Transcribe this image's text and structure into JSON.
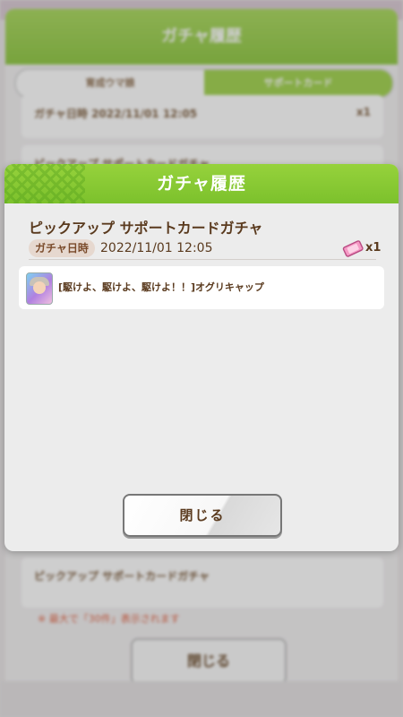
{
  "background": {
    "header_title": "ガチャ履歴",
    "tabs": [
      {
        "label": "育成ウマ娘",
        "active": false
      },
      {
        "label": "サポートカード",
        "active": true
      }
    ],
    "first_row": {
      "label": "ガチャ日時",
      "date": "2022/11/01 12:05",
      "count": "x1"
    },
    "second_row_title": "ピックアップ サポートカードガチャ",
    "third_row_title": "ピックアップ サポートカードガチャ",
    "note": "※ 最大で「30件」表示されます",
    "close_label": "閉じる"
  },
  "modal": {
    "title": "ガチャ履歴",
    "gacha_name": "ピックアップ サポートカードガチャ",
    "date_label": "ガチャ日時",
    "date_value": "2022/11/01 12:05",
    "ticket_count": "x1",
    "results": [
      {
        "card_name": "[駆けよ、駆けよ、駆けよ！！]オグリキャップ"
      }
    ],
    "close_label": "閉じる"
  },
  "colors": {
    "header_green": "#8cc63e",
    "text_brown": "#5a3a1e",
    "ticket_pink": "#f07ab0"
  },
  "icons": {
    "ticket": "ticket-icon",
    "card_portrait": "support-card-icon"
  }
}
